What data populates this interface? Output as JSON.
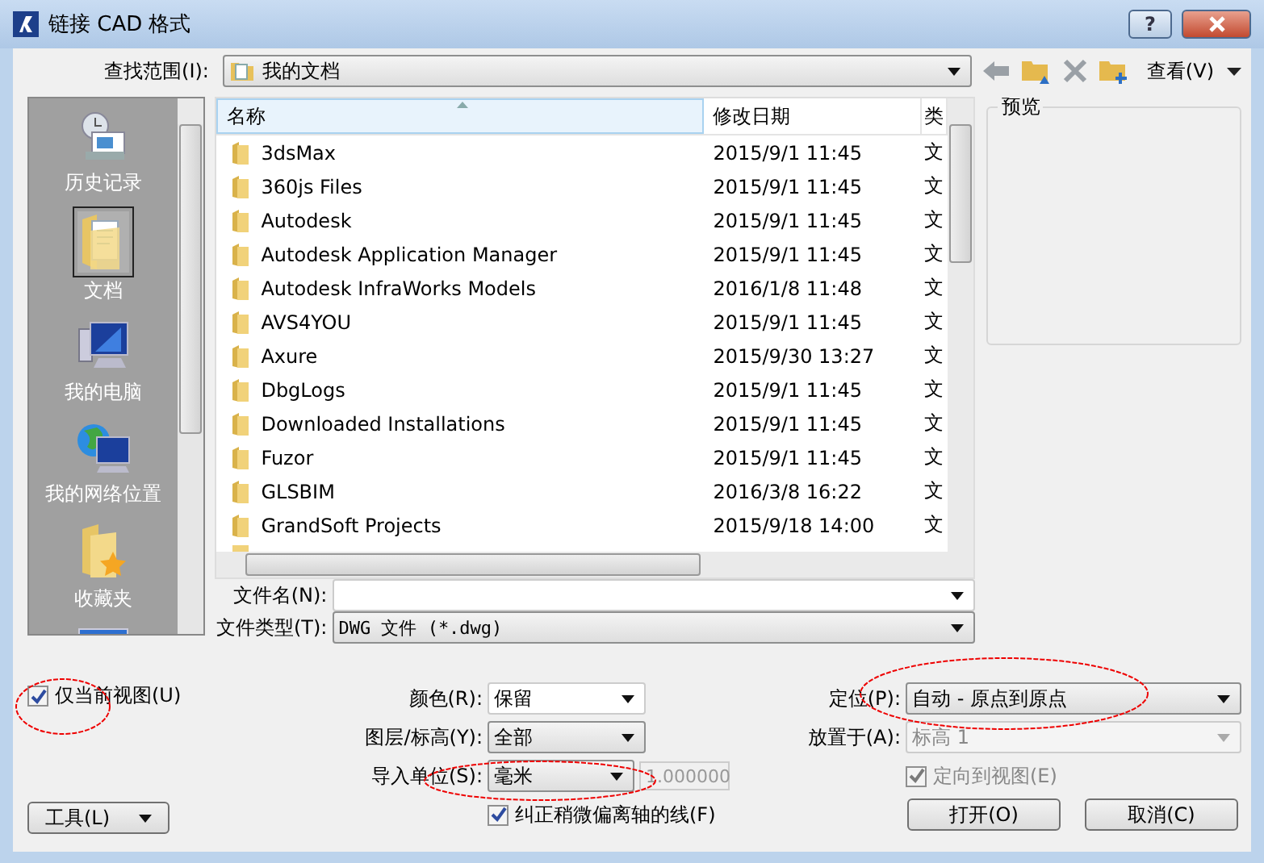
{
  "window": {
    "title": "链接 CAD 格式",
    "help": "?"
  },
  "look_in": {
    "label": "查找范围(I):",
    "value": "我的文档"
  },
  "toolbar": {
    "view_label": "查看(V)"
  },
  "places": [
    {
      "kind": "history",
      "label": "历史记录",
      "selected": false
    },
    {
      "kind": "documents",
      "label": "文档",
      "selected": true
    },
    {
      "kind": "computer",
      "label": "我的电脑",
      "selected": false
    },
    {
      "kind": "network",
      "label": "我的网络位置",
      "selected": false
    },
    {
      "kind": "favorites",
      "label": "收藏夹",
      "selected": false
    },
    {
      "kind": "desktop",
      "selected": false
    }
  ],
  "file_list": {
    "columns": [
      "名称",
      "修改日期",
      "类"
    ],
    "rows": [
      {
        "name": "3dsMax",
        "date": "2015/9/1 11:45",
        "type": "文"
      },
      {
        "name": "360js Files",
        "date": "2015/9/1 11:45",
        "type": "文"
      },
      {
        "name": "Autodesk",
        "date": "2015/9/1 11:45",
        "type": "文"
      },
      {
        "name": "Autodesk Application Manager",
        "date": "2015/9/1 11:45",
        "type": "文"
      },
      {
        "name": "Autodesk InfraWorks Models",
        "date": "2016/1/8 11:48",
        "type": "文"
      },
      {
        "name": "AVS4YOU",
        "date": "2015/9/1 11:45",
        "type": "文"
      },
      {
        "name": "Axure",
        "date": "2015/9/30 13:27",
        "type": "文"
      },
      {
        "name": "DbgLogs",
        "date": "2015/9/1 11:45",
        "type": "文"
      },
      {
        "name": "Downloaded Installations",
        "date": "2015/9/1 11:45",
        "type": "文"
      },
      {
        "name": "Fuzor",
        "date": "2015/9/1 11:45",
        "type": "文"
      },
      {
        "name": "GLSBIM",
        "date": "2016/3/8 16:22",
        "type": "文"
      },
      {
        "name": "GrandSoft Projects",
        "date": "2015/9/18 14:00",
        "type": "文"
      }
    ]
  },
  "preview": {
    "label": "预览"
  },
  "file_name": {
    "label": "文件名(N):"
  },
  "file_type": {
    "label": "文件类型(T):",
    "value": "DWG 文件 (*.dwg)"
  },
  "current_view_only": {
    "label": "仅当前视图(U)",
    "checked": true
  },
  "color": {
    "label": "颜色(R):",
    "value": "保留"
  },
  "layers": {
    "label": "图层/标高(Y):",
    "value": "全部"
  },
  "units": {
    "label": "导入单位(S):",
    "value": "毫米",
    "scale": "1.000000"
  },
  "correct_lines": {
    "label": "纠正稍微偏离轴的线(F)",
    "checked": true
  },
  "positioning": {
    "label": "定位(P):",
    "value": "自动 - 原点到原点"
  },
  "place_at": {
    "label": "放置于(A):",
    "value": "标高 1",
    "disabled": true
  },
  "orient_to_view": {
    "label": "定向到视图(E)",
    "checked": true,
    "disabled": true
  },
  "buttons": {
    "tools": "工具(L)",
    "open": "打开(O)",
    "cancel": "取消(C)"
  }
}
